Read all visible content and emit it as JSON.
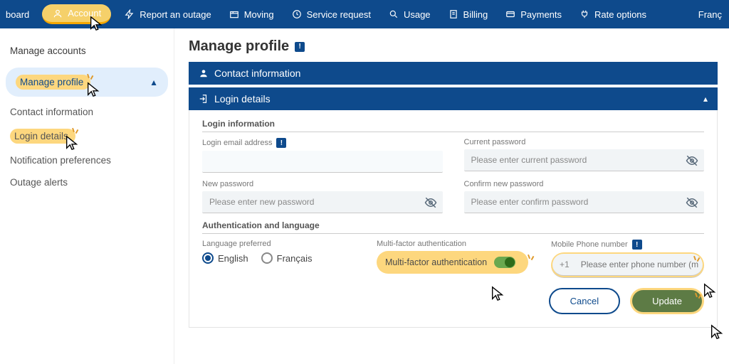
{
  "topnav": {
    "items": [
      {
        "label": "board"
      },
      {
        "label": "Account"
      },
      {
        "label": "Report an outage"
      },
      {
        "label": "Moving"
      },
      {
        "label": "Service request"
      },
      {
        "label": "Usage"
      },
      {
        "label": "Billing"
      },
      {
        "label": "Payments"
      },
      {
        "label": "Rate options"
      }
    ],
    "lang": "Franç"
  },
  "sidebar": {
    "manage_accounts": "Manage accounts",
    "manage_profile": "Manage profile",
    "contact_info": "Contact information",
    "login_details": "Login details",
    "notif_prefs": "Notification preferences",
    "outage_alerts": "Outage alerts"
  },
  "page": {
    "title": "Manage profile"
  },
  "panels": {
    "contact_header": "Contact information",
    "login_header": "Login details"
  },
  "login": {
    "section1": "Login information",
    "email_label": "Login email address",
    "current_pw_label": "Current password",
    "current_pw_placeholder": "Please enter current password",
    "new_pw_label": "New password",
    "new_pw_placeholder": "Please enter new password",
    "confirm_pw_label": "Confirm new password",
    "confirm_pw_placeholder": "Please enter confirm password",
    "section2": "Authentication and language",
    "lang_label": "Language preferred",
    "lang_en": "English",
    "lang_fr": "Français",
    "mfa_label": "Multi-factor authentication",
    "mfa_toggle_label": "Multi-factor authentication",
    "phone_label": "Mobile Phone number",
    "phone_cc": "+1",
    "phone_placeholder": "Please enter phone number (mobi",
    "cancel": "Cancel",
    "update": "Update"
  }
}
